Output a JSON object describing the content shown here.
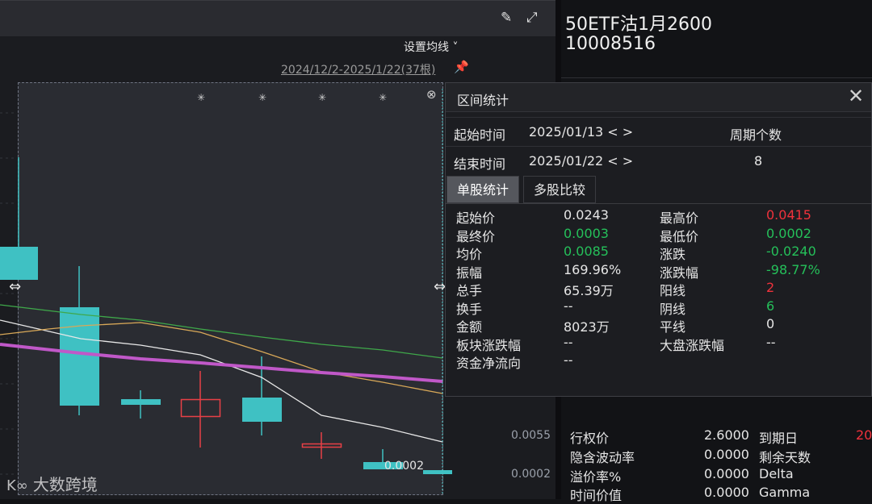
{
  "toolbar": {
    "brush_icon": "brush-icon",
    "fullscreen_icon": "expand-icon",
    "ma_setting_label": "设置均线 ˅",
    "range_label": "2024/12/2-2025/1/22(37根)",
    "pin_icon": "pin-icon"
  },
  "chart": {
    "close_symbol": "⊗",
    "star_symbol": "✳",
    "drag_symbol": "⇔",
    "last_price_label": "0.0002",
    "axis_labels": [
      "0.0055",
      "0.0002"
    ]
  },
  "watermark": {
    "logo": "K∞",
    "text": "大数跨境"
  },
  "option": {
    "name": "50ETF沽1月2600",
    "code": "10008516",
    "rows": [
      {
        "label": "行权价",
        "value": "2.6000",
        "label2": "到期日",
        "value2": "20"
      },
      {
        "label": "隐含波动率",
        "value": "0.0000",
        "label2": "剩余天数",
        "value2": ""
      },
      {
        "label": "溢价率%",
        "value": "0.0000",
        "label2": "Delta",
        "value2": ""
      },
      {
        "label": "时间价值",
        "value": "0.0000",
        "label2": "Gamma",
        "value2": ""
      }
    ]
  },
  "popup": {
    "title": "区间统计",
    "close_symbol": "✕",
    "start_label": "起始时间",
    "start_value": "2025/01/13 < >",
    "end_label": "结束时间",
    "end_value": "2025/01/22 < >",
    "period_label": "周期个数",
    "period_value": "8",
    "tabs": [
      "单股统计",
      "多股比较"
    ],
    "stats_left": [
      {
        "label": "起始价",
        "value": "0.0243",
        "tone": "neutral"
      },
      {
        "label": "最终价",
        "value": "0.0003",
        "tone": "down"
      },
      {
        "label": "均价",
        "value": "0.0085",
        "tone": "down"
      },
      {
        "label": "振幅",
        "value": "169.96%",
        "tone": "neutral"
      },
      {
        "label": "总手",
        "value": "65.39万",
        "tone": "neutral"
      },
      {
        "label": "换手",
        "value": "--",
        "tone": "neutral"
      },
      {
        "label": "金额",
        "value": "8023万",
        "tone": "neutral"
      },
      {
        "label": "板块涨跌幅",
        "value": "--",
        "tone": "neutral"
      },
      {
        "label": "资金净流向",
        "value": "--",
        "tone": "neutral"
      }
    ],
    "stats_right": [
      {
        "label": "最高价",
        "value": "0.0415",
        "tone": "up"
      },
      {
        "label": "最低价",
        "value": "0.0002",
        "tone": "down"
      },
      {
        "label": "涨跌",
        "value": "-0.0240",
        "tone": "down"
      },
      {
        "label": "涨跌幅",
        "value": "-98.77%",
        "tone": "down"
      },
      {
        "label": "阳线",
        "value": "2",
        "tone": "up"
      },
      {
        "label": "阴线",
        "value": "6",
        "tone": "down"
      },
      {
        "label": "平线",
        "value": "0",
        "tone": "neutral"
      },
      {
        "label": "大盘涨跌幅",
        "value": "--",
        "tone": "neutral"
      }
    ]
  },
  "colors": {
    "up": "#f0323c",
    "down": "#25c05a",
    "candle_down_fill": "#3fc1c3",
    "ma_short": "#e8e8e8",
    "ma_mid": "#d8a858",
    "ma_long": "#3fa84a",
    "ma_thick": "#c058c8"
  }
}
